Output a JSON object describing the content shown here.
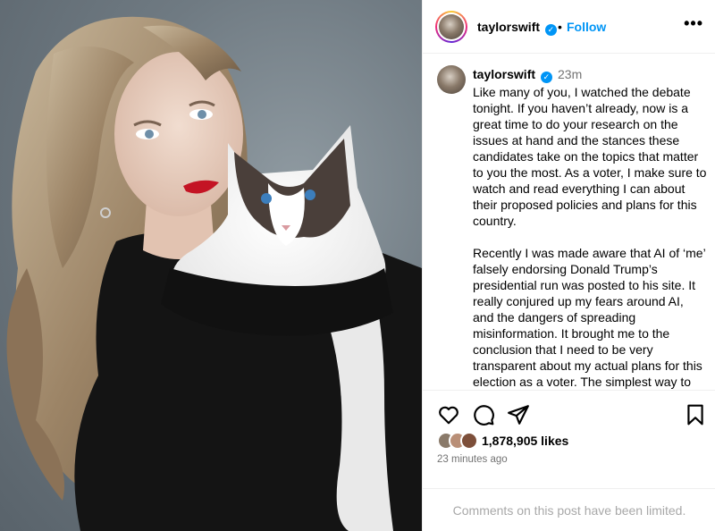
{
  "post": {
    "username": "taylorswift",
    "follow_label": "Follow",
    "dot": "•",
    "more_label": "•••",
    "verified_glyph": "✓",
    "time_short": "23m",
    "caption_p1": "Like many of you, I watched the debate tonight. If you haven’t already, now is a great time to do your research on the issues at hand and the stances these candidates take on the topics that matter to you the most. As a voter, I make sure to watch and read everything I can about their proposed policies and plans for this country.",
    "caption_p2": "Recently I was made aware that AI of ‘me’ falsely endorsing Donald Trump’s presidential run was posted to his site. It really conjured up my fears around AI, and the dangers of spreading misinformation. It brought me to the conclusion that I need to be very transparent about my actual plans for this election as a voter. The simplest way to combat misinformation is with the truth.",
    "likes": "1,878,905 likes",
    "time_ago": "23 minutes ago",
    "comments_limited": "Comments on this post have been limited."
  },
  "icons": {
    "heart": "heart-icon",
    "comment": "comment-icon",
    "share": "share-icon",
    "save": "bookmark-icon",
    "verified": "verified-badge-icon"
  },
  "colors": {
    "accent": "#0095f6",
    "muted": "#737373",
    "limited": "#a8a8a8"
  }
}
